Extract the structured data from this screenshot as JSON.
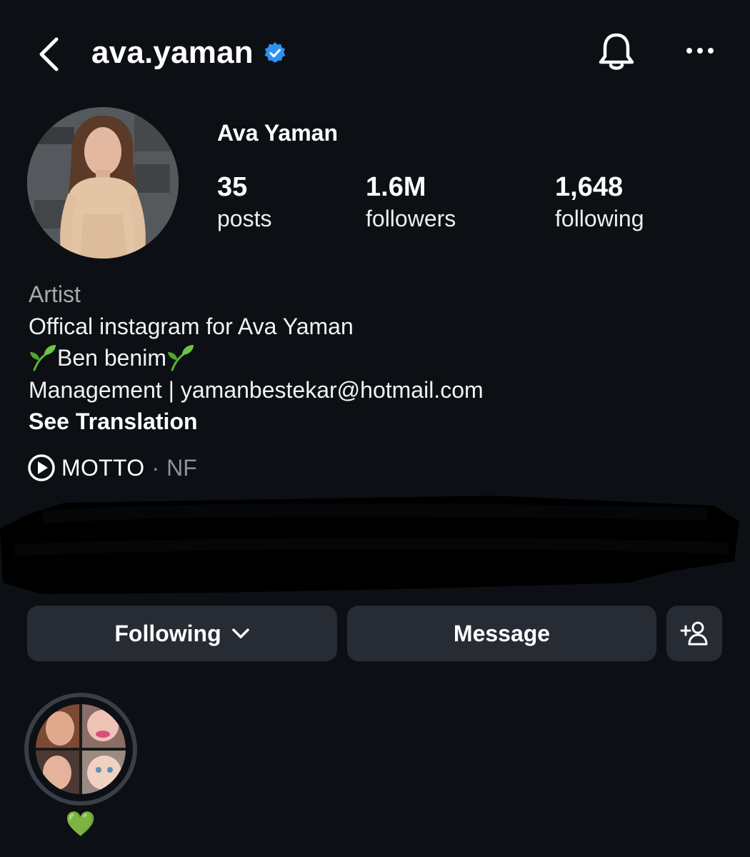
{
  "header": {
    "username": "ava.yaman",
    "verified_icon": "verified-badge-icon",
    "back_icon": "chevron-left-icon",
    "bell_icon": "bell-icon",
    "more_icon": "more-horizontal-icon"
  },
  "profile": {
    "display_name": "Ava Yaman",
    "stats": {
      "posts_value": "35",
      "posts_label": "posts",
      "followers_value": "1.6M",
      "followers_label": "followers",
      "following_value": "1,648",
      "following_label": "following"
    }
  },
  "bio": {
    "category": "Artist",
    "line1": "Offical instagram for Ava Yaman",
    "line2_text": "Ben benim",
    "line2_emoji": "🌱",
    "line3": "Management | yamanbestekar@hotmail.com",
    "see_translation": "See Translation"
  },
  "music": {
    "title": "MOTTO",
    "separator": "·",
    "artist": "NF",
    "icon": "play-circle-icon"
  },
  "actions": {
    "following_label": "Following",
    "message_label": "Message",
    "add_user_icon": "add-person-icon"
  },
  "highlights": [
    {
      "label": "💚"
    }
  ],
  "colors": {
    "background": "#0c0f14",
    "button_bg": "#272b33",
    "verified_blue": "#2f8ff3",
    "muted_text": "#a7a9ad",
    "highlight_ring": "#3a3f47"
  }
}
